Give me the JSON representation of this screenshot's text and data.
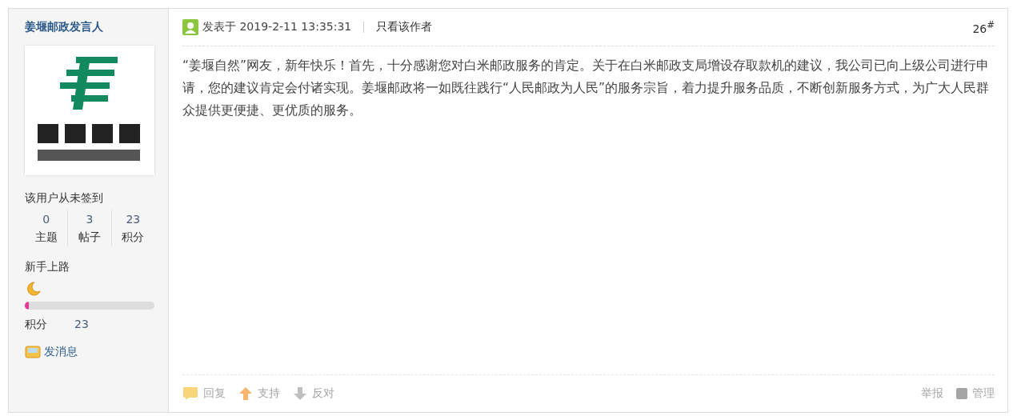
{
  "author": {
    "name": "姜堰邮政发言人",
    "checkin": "该用户从未签到",
    "stats": [
      {
        "value": "0",
        "label": "主题"
      },
      {
        "value": "3",
        "label": "帖子"
      },
      {
        "value": "23",
        "label": "积分"
      }
    ],
    "rank": "新手上路",
    "level": 0.03,
    "points_label": "积分",
    "points_value": "23",
    "message": "发消息"
  },
  "post": {
    "posted": "发表于 2019-2-11 13:35:31",
    "only_author": "只看该作者",
    "floor": "26$^{#}$",
    "body": "“姜堰自然”网友，新年快乐！首先，十分感谢您对白米邮政服务的肯定。关于在白米邮政支局增设存取款机的建议，我公司已向上级公司进行申请，您的建议肯定会付诸实现。姜堰邮政将一如既往践行“人民邮政为人民”的服务宗旨，着力提升服务品质，不断创新服务方式，为广大人民群众提供更便捷、更优质的服务。"
  },
  "actions": [
    {
      "kind": "reply",
      "label": "回复"
    },
    {
      "kind": "up",
      "label": "支持"
    },
    {
      "kind": "down",
      "label": "反对"
    }
  ],
  "admin_actions": [
    {
      "kind": "report",
      "label": "举报"
    },
    {
      "kind": "manage",
      "label": "管理"
    }
  ]
}
